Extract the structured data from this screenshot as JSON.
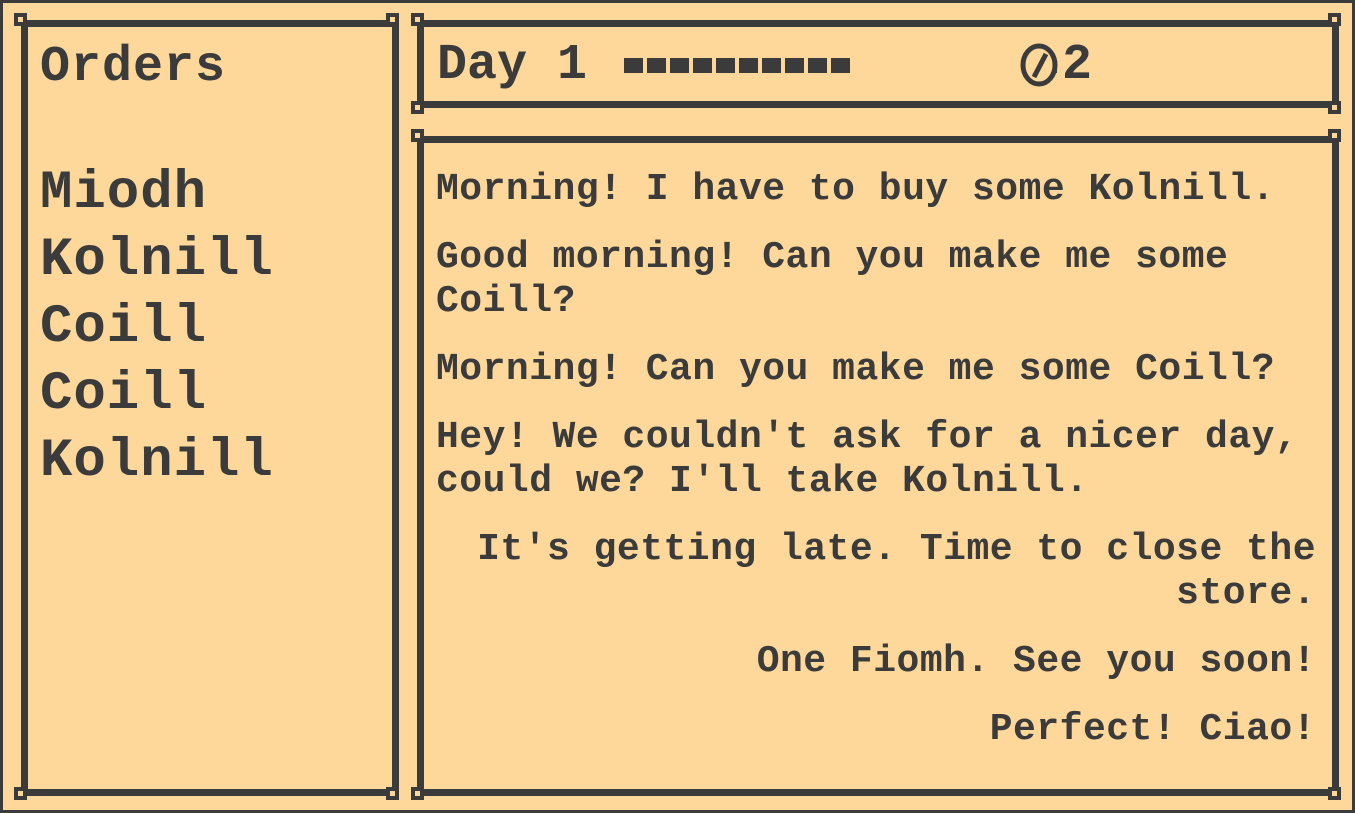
{
  "orders": {
    "title": "Orders",
    "items": [
      "Miodh",
      "Kolnill",
      "Coill",
      "Coill",
      "Kolnill"
    ]
  },
  "status": {
    "day_label": "Day 1",
    "day_progress_ticks": 10,
    "coin_icon": "coin-icon",
    "coins": "2"
  },
  "log": {
    "messages": [
      {
        "speaker": "customer",
        "text": "Morning! I have to buy some Kolnill."
      },
      {
        "speaker": "customer",
        "text": "Good morning! Can you make me some Coill?"
      },
      {
        "speaker": "customer",
        "text": "Morning! Can you make me some Coill?"
      },
      {
        "speaker": "customer",
        "text": "Hey! We couldn't ask for a nicer day, could we? I'll take Kolnill."
      },
      {
        "speaker": "shop",
        "text": "It's getting late. Time to close the store."
      },
      {
        "speaker": "shop",
        "text": "One Fiomh. See you soon!"
      },
      {
        "speaker": "shop",
        "text": "Perfect! Ciao!"
      }
    ]
  },
  "colors": {
    "background": "#fdd89a",
    "ink": "#3b3b3b"
  }
}
